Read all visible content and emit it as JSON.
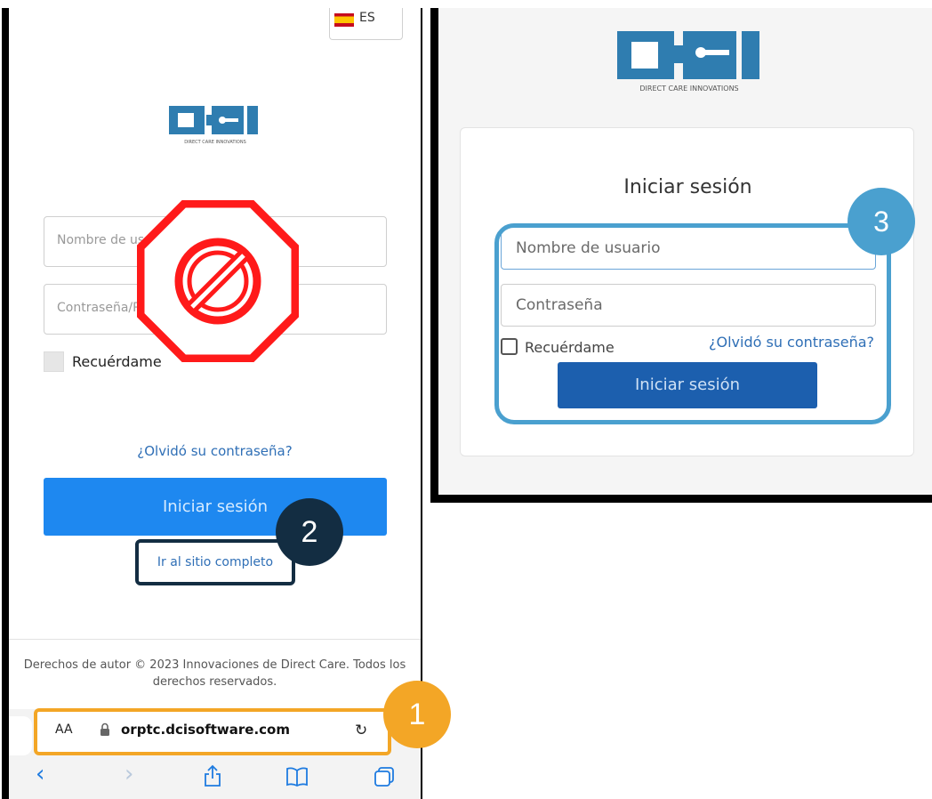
{
  "phone": {
    "language": "ES",
    "logo_caption": "DIRECT CARE INNOVATIONS",
    "username_placeholder": "Nombre de us",
    "password_placeholder": "Contraseña/P",
    "remember_label": "Recuérdame",
    "forgot_link": "¿Olvidó su contraseña?",
    "login_button": "Iniciar sesión",
    "full_site_link": "Ir al sitio completo",
    "copyright": "Derechos de autor © 2023 Innovaciones de Direct Care. Todos los derechos reservados.",
    "browser": {
      "text_size_label": "AA",
      "url": "orptc.dcisoftware.com",
      "icons": [
        "lock-icon",
        "reload-icon",
        "back-icon",
        "forward-icon",
        "share-icon",
        "bookmarks-icon",
        "tabs-icon"
      ]
    }
  },
  "desktop": {
    "logo_caption": "DIRECT CARE INNOVATIONS",
    "title": "Iniciar sesión",
    "username_placeholder": "Nombre de usuario",
    "password_placeholder": "Contraseña",
    "remember_label": "Recuérdame",
    "forgot_link": "¿Olvidó su contraseña?",
    "login_button": "Iniciar sesión"
  },
  "annotations": {
    "step1": "1",
    "step2": "2",
    "step3": "3"
  },
  "colors": {
    "brand": "#2f7db0",
    "mobile_button": "#1e88f0",
    "desktop_button": "#1c5fae",
    "step1": "#f3a626",
    "step2": "#132d42",
    "step3": "#4aa0cf",
    "prohibited": "#ff1a1a"
  }
}
